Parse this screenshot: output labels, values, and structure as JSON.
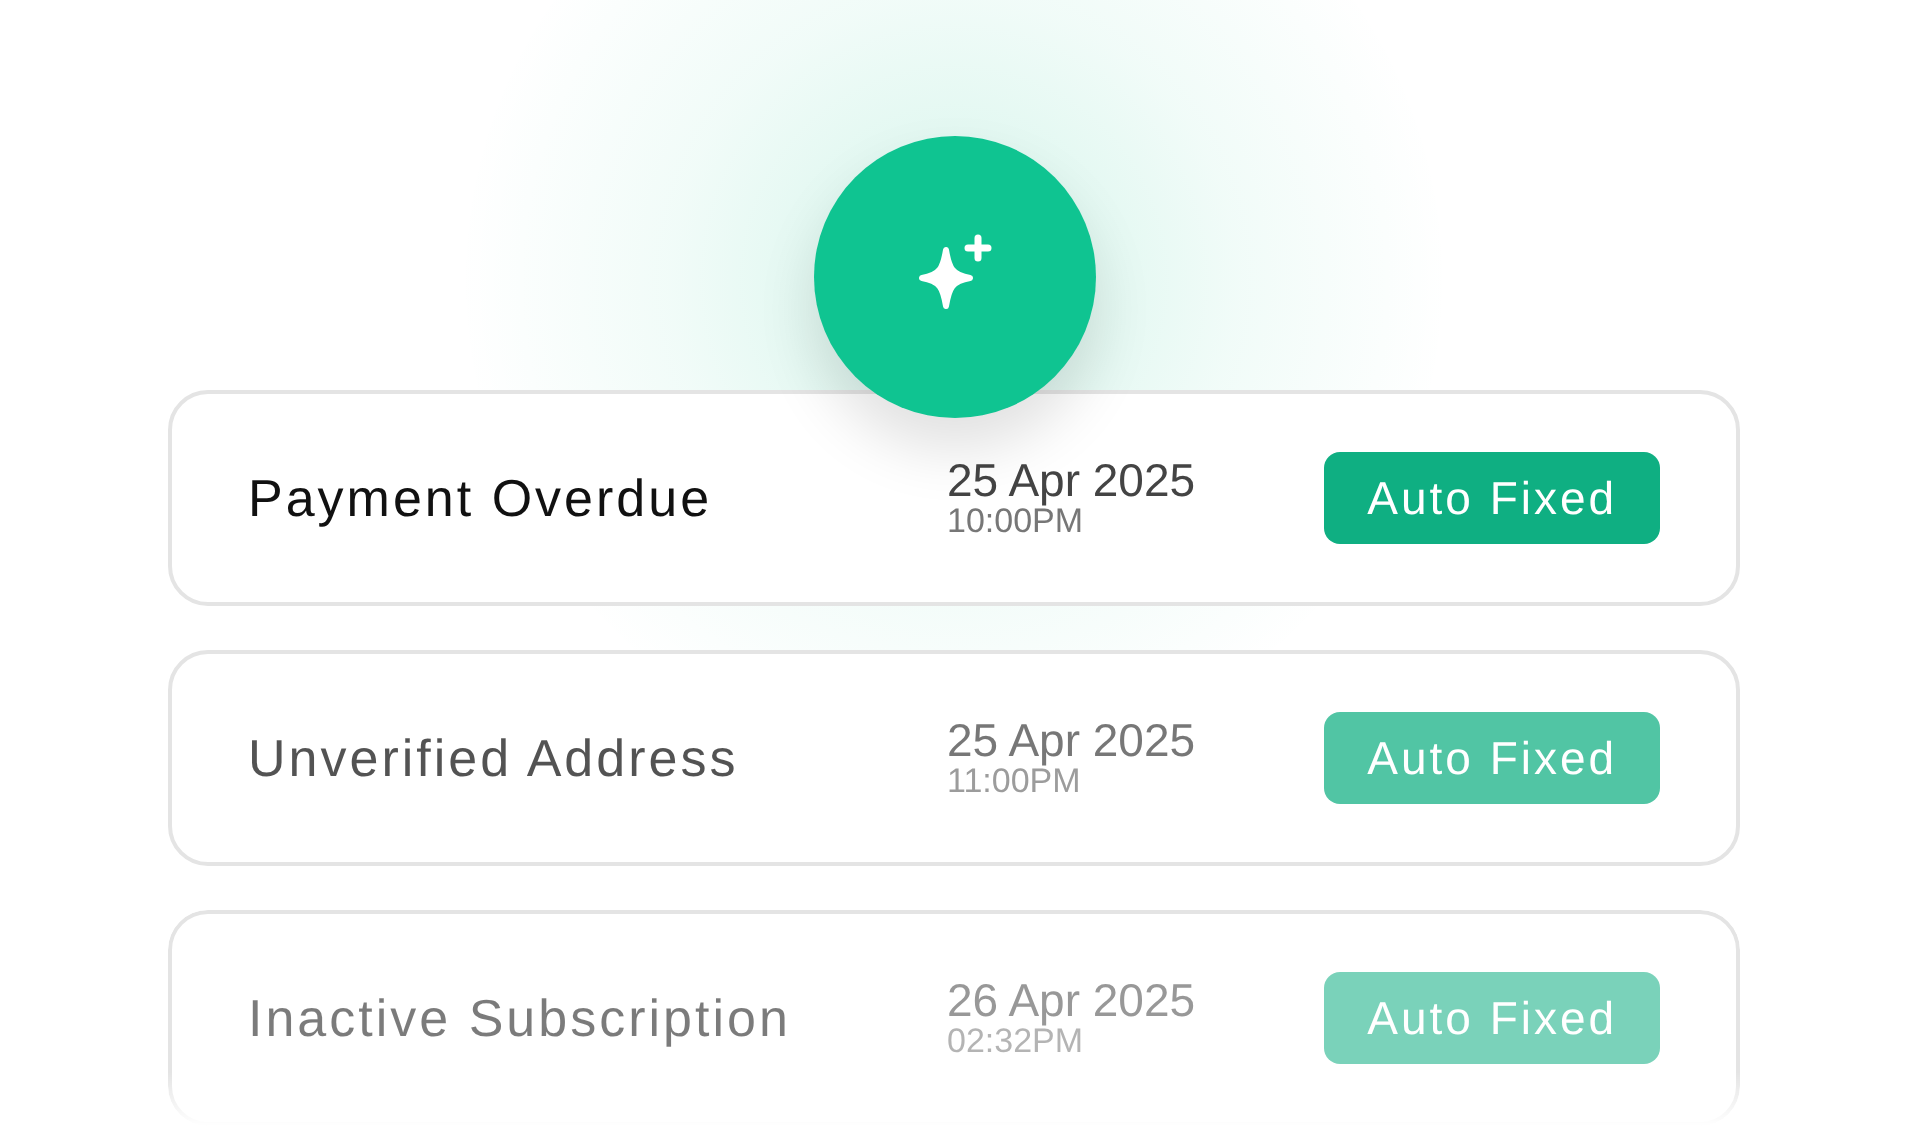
{
  "alerts": [
    {
      "title": "Payment Overdue",
      "date": "25 Apr 2025",
      "time": "10:00PM",
      "status": "Auto Fixed"
    },
    {
      "title": "Unverified Address",
      "date": "25 Apr 2025",
      "time": "11:00PM",
      "status": "Auto Fixed"
    },
    {
      "title": "Inactive Subscription",
      "date": "26 Apr 2025",
      "time": "02:32PM",
      "status": "Auto Fixed"
    }
  ]
}
